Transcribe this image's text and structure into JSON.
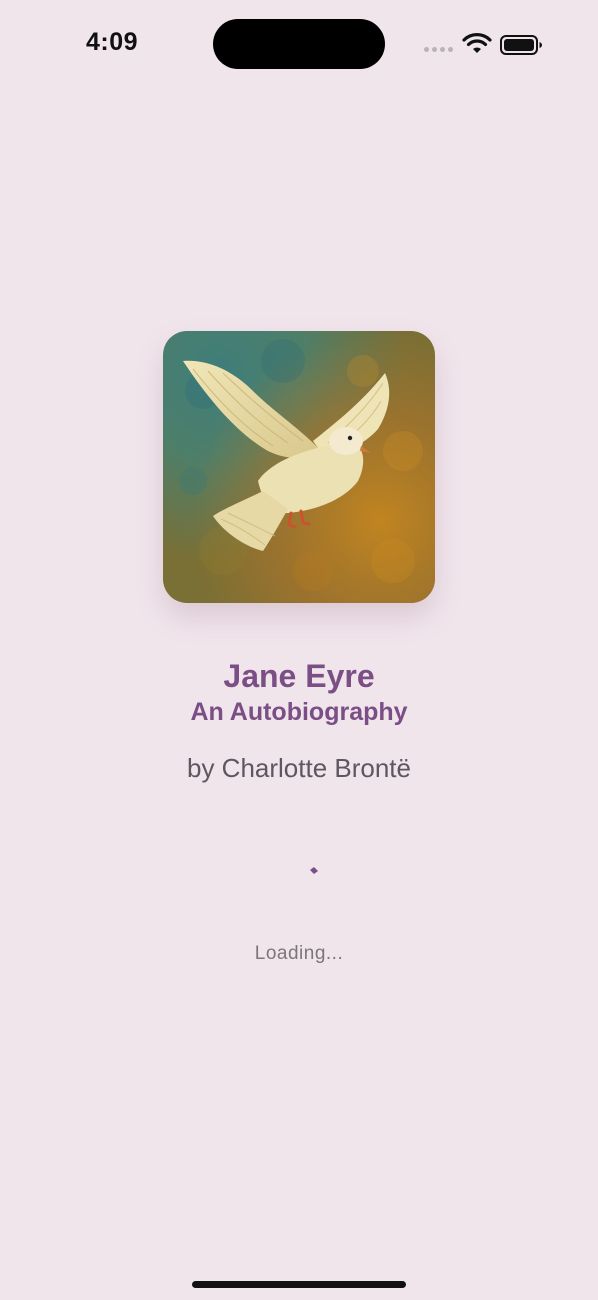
{
  "status_bar": {
    "time": "4:09"
  },
  "book": {
    "title": "Jane Eyre",
    "subtitle": "An Autobiography",
    "author": "by Charlotte Brontë",
    "cover_icon": "dove-painting"
  },
  "loading": {
    "text": "Loading..."
  },
  "colors": {
    "background": "#f1e5ec",
    "accent": "#7b4f86",
    "author_text": "#5e5660",
    "loading_text": "#7d7579"
  }
}
